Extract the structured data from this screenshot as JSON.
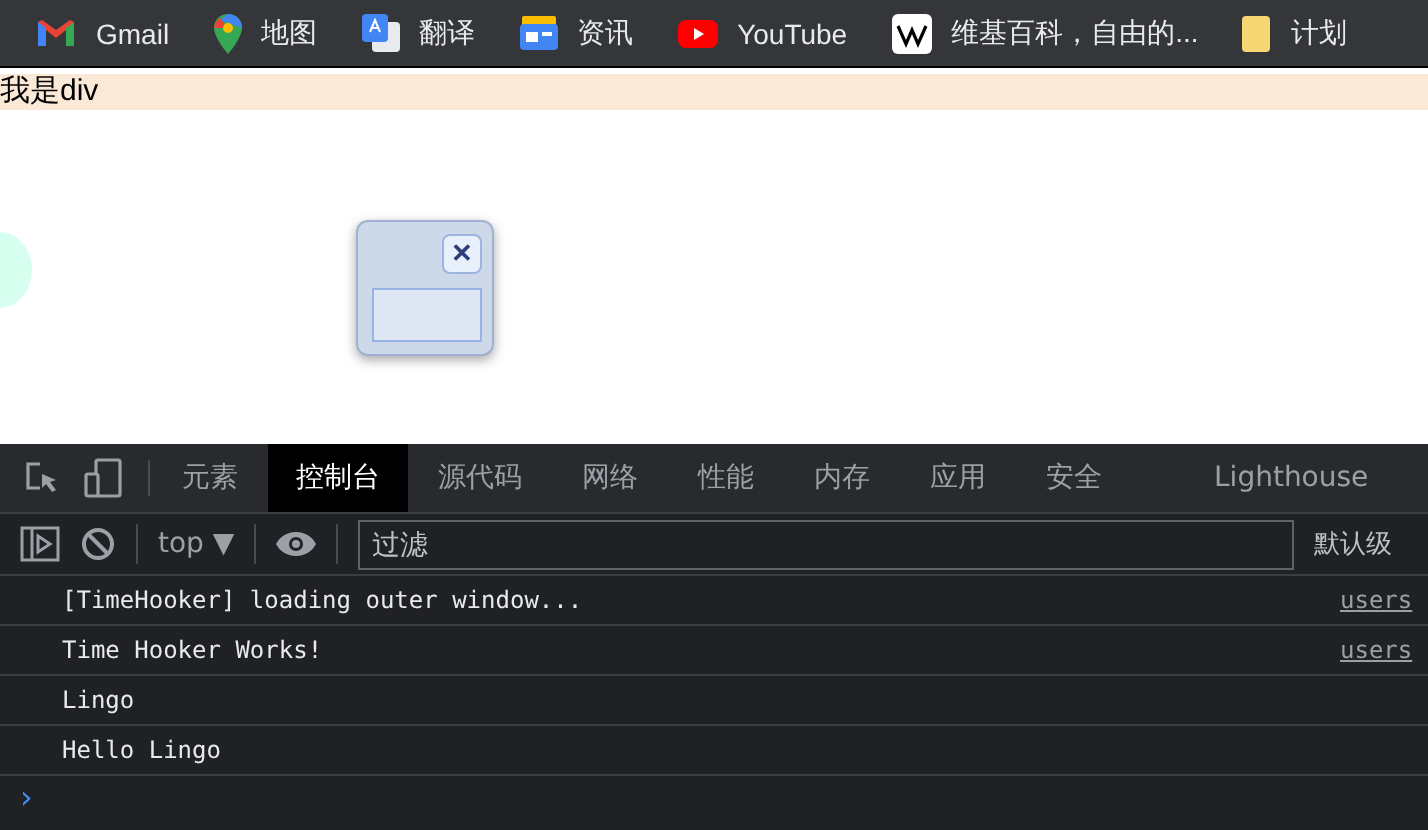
{
  "bookmarks": [
    {
      "label": "Gmail",
      "kind": "mail"
    },
    {
      "label": "地图",
      "kind": "pin"
    },
    {
      "label": "翻译",
      "kind": "translate"
    },
    {
      "label": "资讯",
      "kind": "news"
    },
    {
      "label": "YouTube",
      "kind": "video"
    },
    {
      "label": "维基百科，自由的...",
      "kind": "wiki"
    },
    {
      "label": "计划",
      "kind": "folder"
    }
  ],
  "page": {
    "div_text": "我是div",
    "dialog": {
      "close_label": "✕"
    }
  },
  "devtools": {
    "tabs": [
      {
        "label": "元素",
        "selected": false
      },
      {
        "label": "控制台",
        "selected": true
      },
      {
        "label": "源代码",
        "selected": false
      },
      {
        "label": "网络",
        "selected": false
      },
      {
        "label": "性能",
        "selected": false
      },
      {
        "label": "内存",
        "selected": false
      },
      {
        "label": "应用",
        "selected": false
      },
      {
        "label": "安全",
        "selected": false
      },
      {
        "label": "Lighthouse",
        "selected": false
      }
    ],
    "context": "top ▼",
    "filter_placeholder": "过滤",
    "levels": "默认级",
    "messages": [
      {
        "text": "[TimeHooker] loading outer window...",
        "source": "users"
      },
      {
        "text": "Time Hooker Works!",
        "source": "users"
      },
      {
        "text": "Lingo"
      },
      {
        "text": "Hello Lingo"
      }
    ],
    "prompt": "›"
  }
}
